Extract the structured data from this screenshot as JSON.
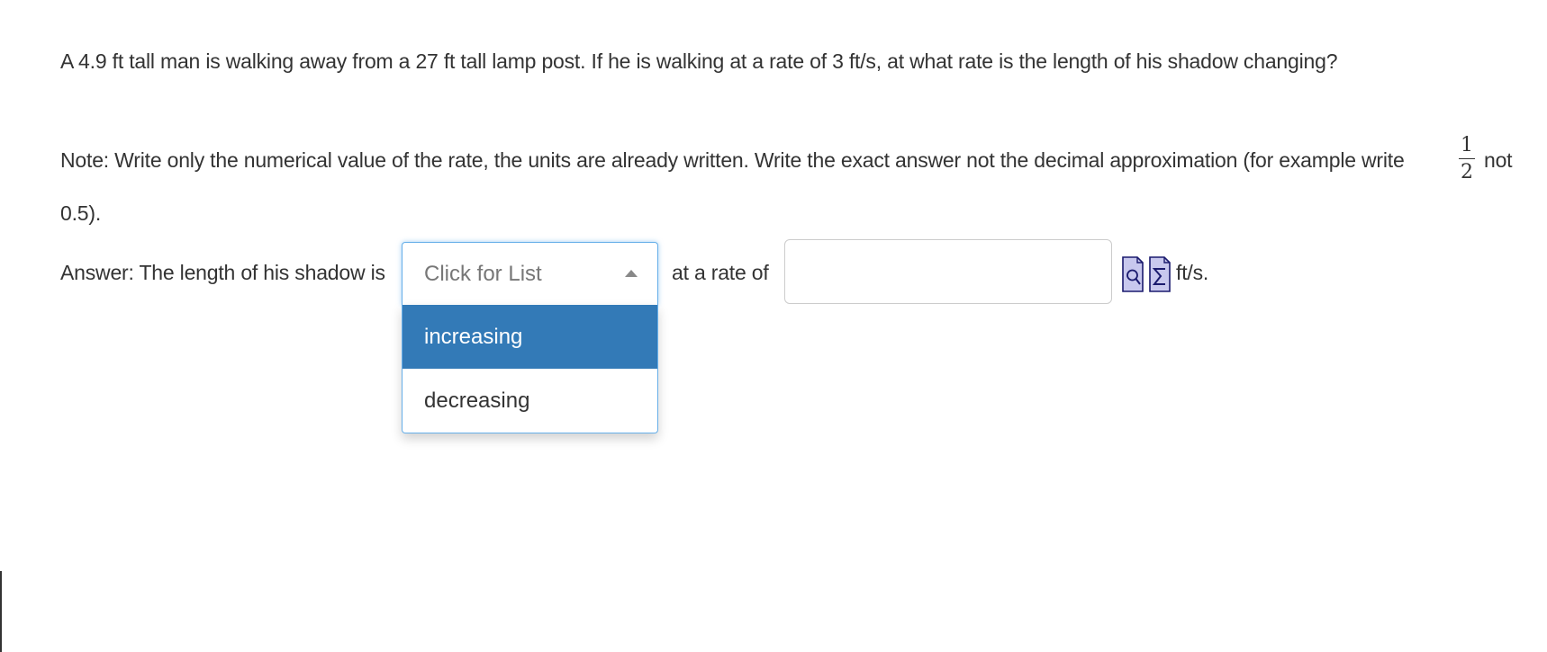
{
  "question": {
    "text": "A 4.9 ft tall man is walking away from a 27 ft tall lamp post.  If he is walking at a rate of 3 ft/s, at what rate is the length of his shadow changing?"
  },
  "note": {
    "line1": "Note: Write only the numerical value of the rate, the units are already written. Write the exact answer not the decimal approximation (for example write",
    "fraction_numerator": "1",
    "fraction_denominator": "2",
    "after_fraction": "not",
    "line2": "0.5)."
  },
  "answer": {
    "prefix": "Answer: The length of his shadow is",
    "select": {
      "placeholder": "Click for List",
      "options": [
        "increasing",
        "decreasing"
      ],
      "highlighted_option": "increasing",
      "expanded": true
    },
    "rate_label": "at a rate of",
    "rate_input_value": "",
    "units": "ft/s."
  },
  "icons": {
    "preview": "preview-document-icon",
    "equation": "equation-editor-sigma-icon"
  },
  "colors": {
    "highlight": "#337ab7",
    "focus_border": "#66afe9",
    "text": "#333333",
    "icon_fill": "#c8c8ee",
    "icon_stroke": "#1a1a6e"
  }
}
